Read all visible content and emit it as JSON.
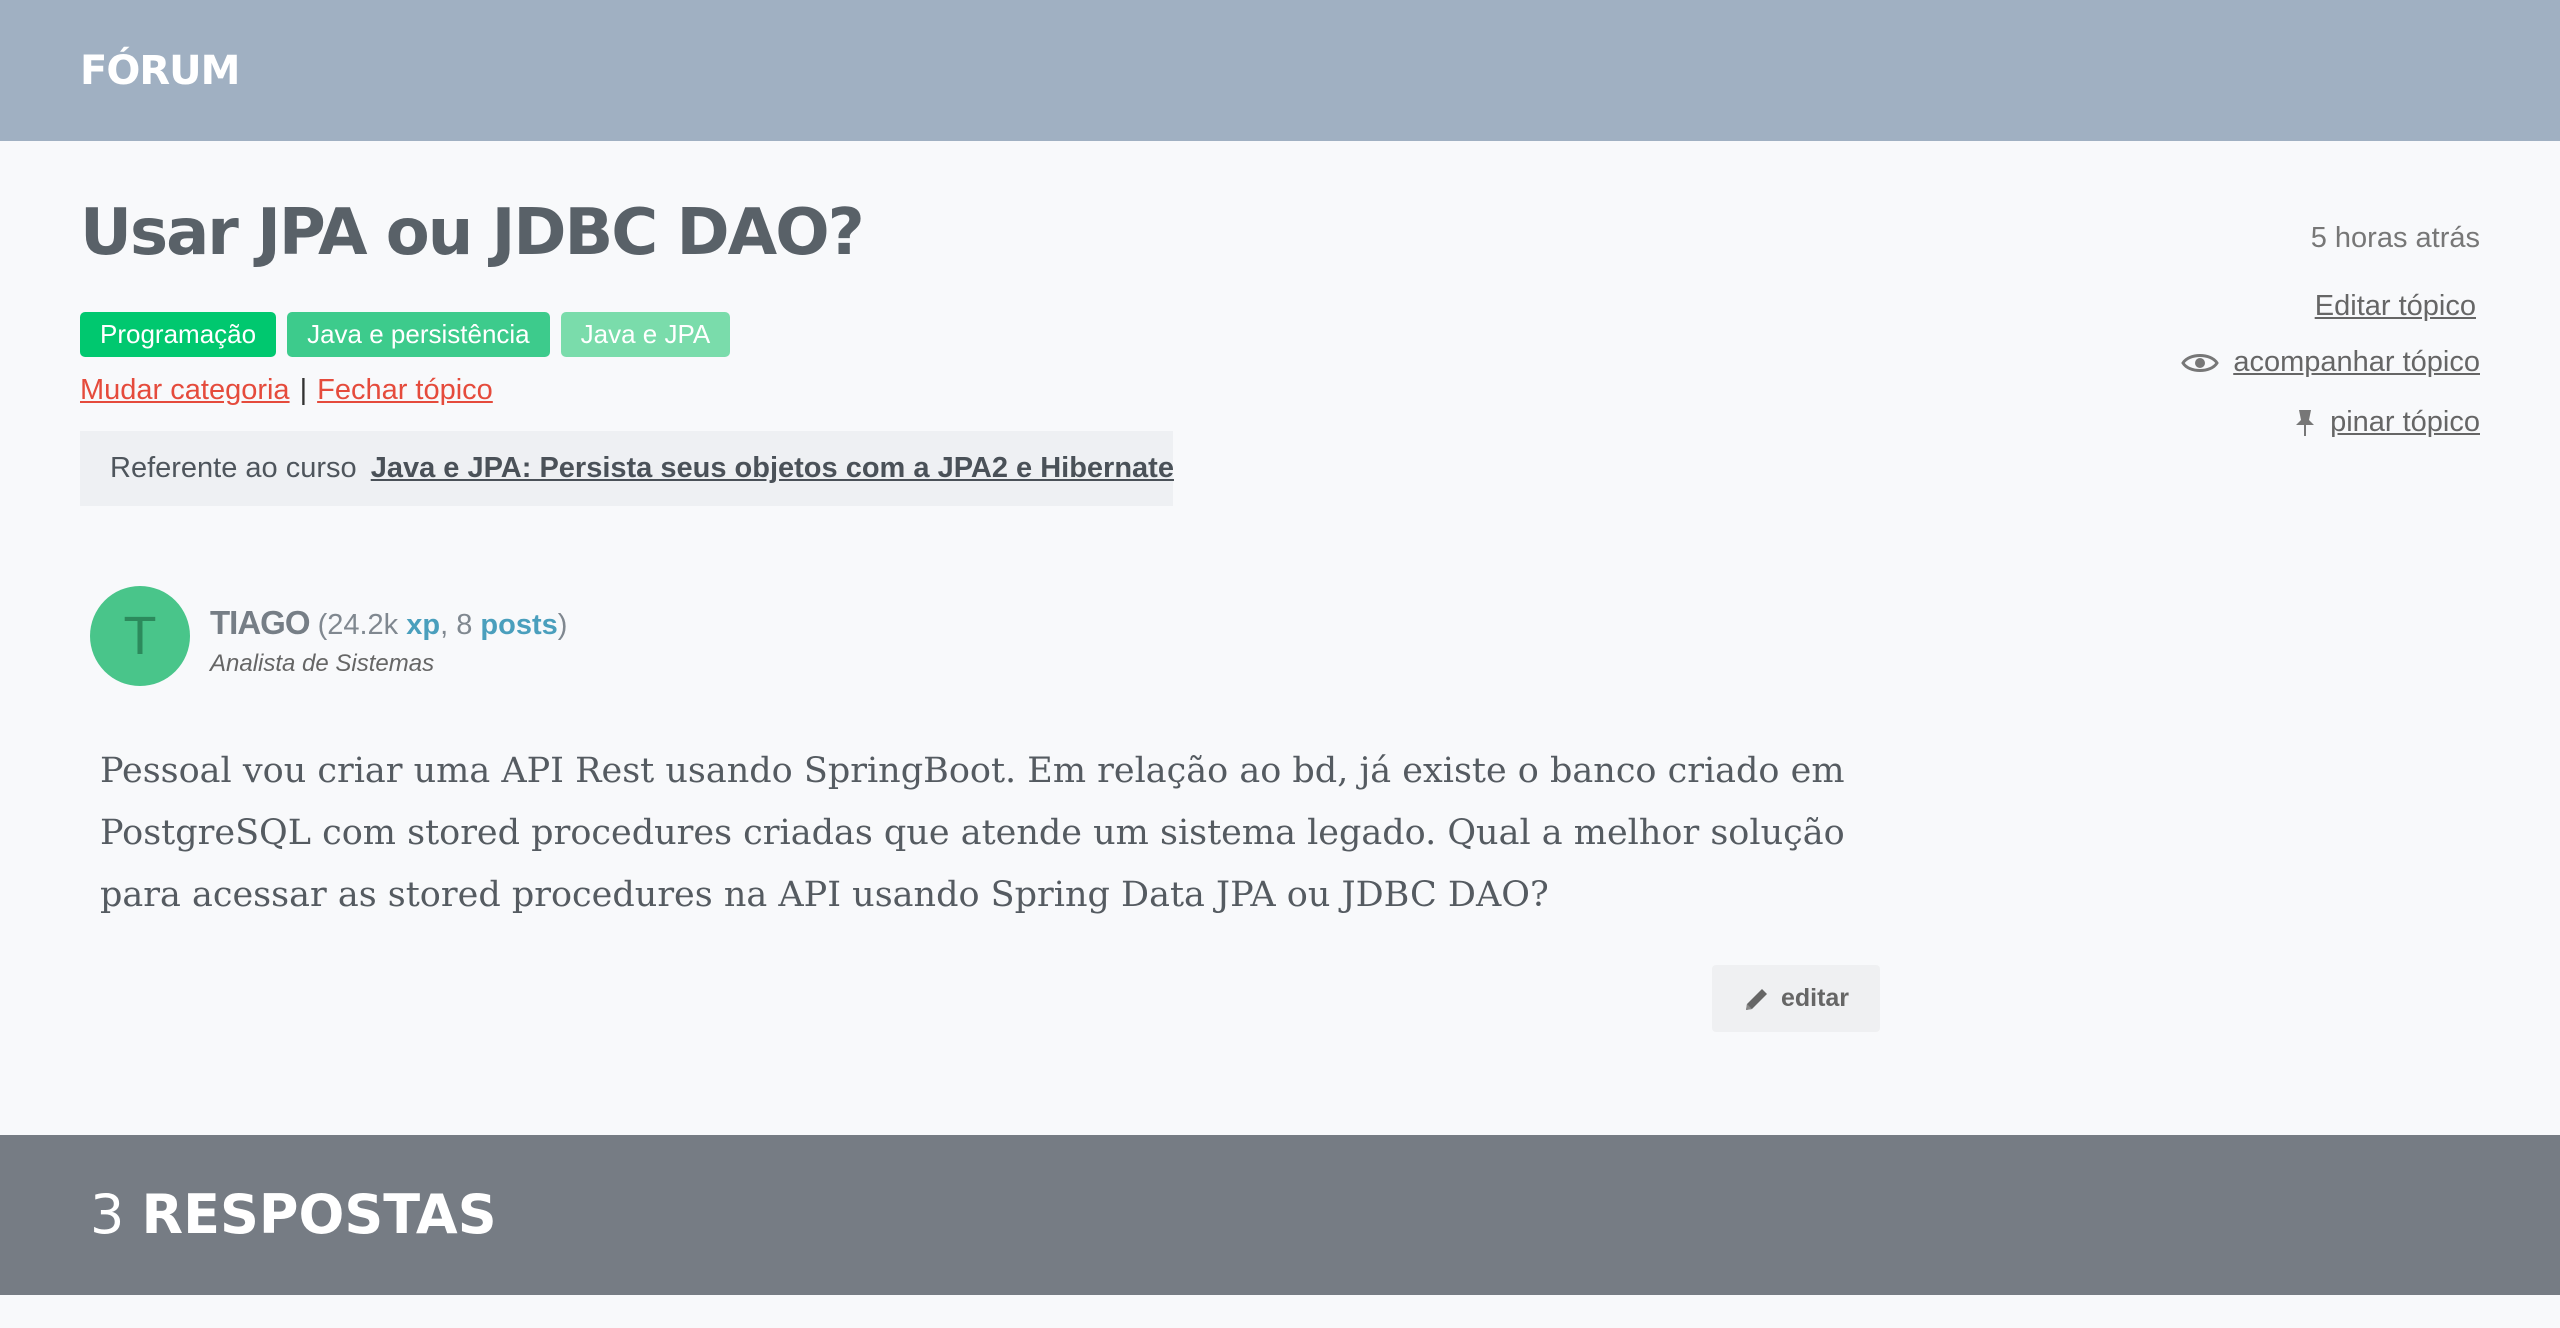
{
  "header": {
    "brand": "FÓRUM"
  },
  "topic": {
    "title": "Usar JPA ou JDBC DAO?",
    "tags": [
      "Programação",
      "Java e persistência",
      "Java e JPA"
    ],
    "actions": {
      "change_category": "Mudar categoria",
      "separator": "|",
      "close_topic": "Fechar tópico"
    },
    "course": {
      "prefix": "Referente ao curso",
      "name": "Java e JPA: Persista seus objetos com a JPA2 e Hibernate"
    },
    "timestamp": "5 horas atrás",
    "side_links": {
      "edit": "Editar tópico",
      "follow": "acompanhar tópico",
      "pin": "pinar tópico"
    }
  },
  "post": {
    "avatar_letter": "T",
    "author_name": "TIAGO",
    "xp_open": "(24.2k",
    "xp_label": "xp",
    "posts_count": ", 8",
    "posts_label": "posts",
    "close": ")",
    "role": "Analista de Sistemas",
    "body": "Pessoal vou criar uma API Rest usando SpringBoot. Em relação ao bd, já existe o banco criado em PostgreSQL com stored procedures criadas que atende um sistema legado. Qual a melhor solução para acessar as stored procedures na API usando Spring Data JPA ou JDBC DAO?",
    "edit_label": "editar"
  },
  "answers": {
    "count": "3",
    "label": "RESPOSTAS"
  },
  "colors": {
    "header_bg": "#a0b0c2",
    "tag_green": "#00c86f",
    "link_red": "#e54b3c",
    "answers_bg": "#767c84"
  }
}
